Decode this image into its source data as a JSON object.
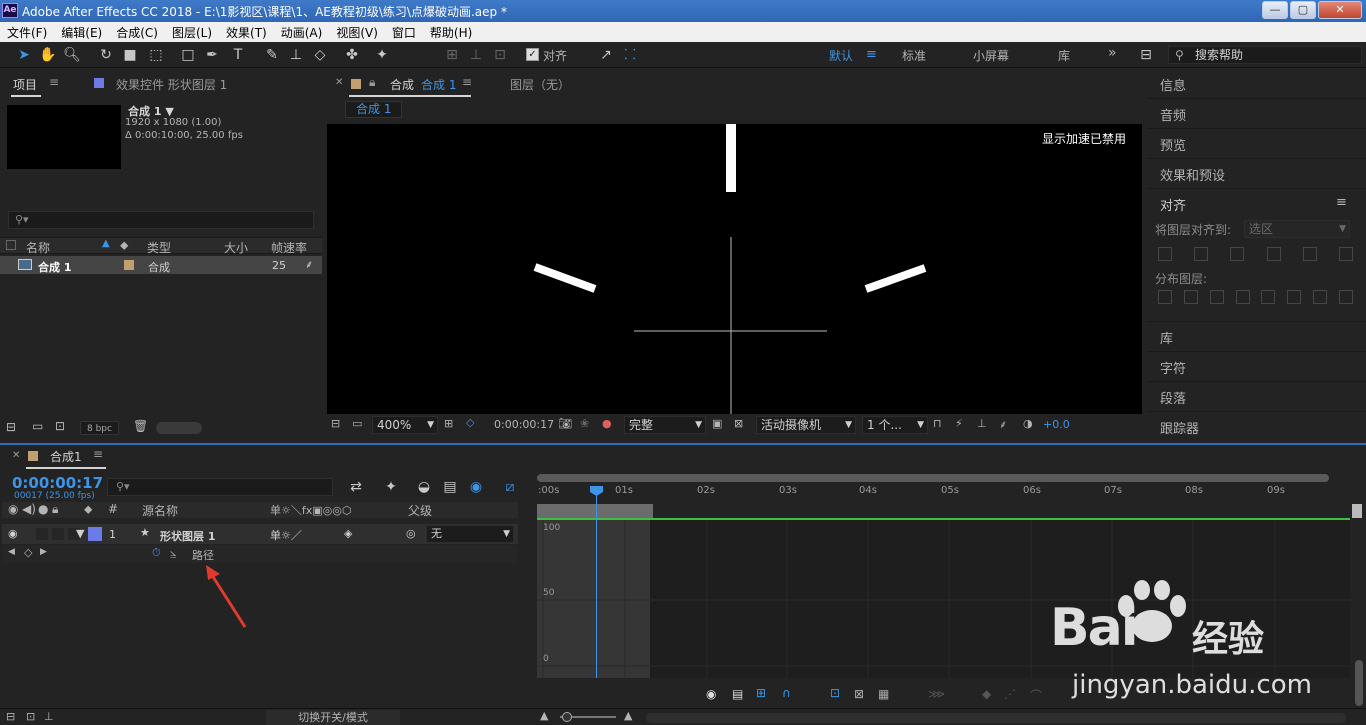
{
  "window": {
    "app_logo": "Ae",
    "title": "Adobe After Effects CC 2018 - E:\\1影视区\\课程\\1、AE教程初级\\练习\\点爆破动画.aep *",
    "buttons": {
      "minimize": "—",
      "maximize": "▢",
      "close": "✕"
    }
  },
  "menu": [
    "文件(F)",
    "编辑(E)",
    "合成(C)",
    "图层(L)",
    "效果(T)",
    "动画(A)",
    "视图(V)",
    "窗口",
    "帮助(H)"
  ],
  "toolbar": {
    "snap_label": "对齐",
    "workspaces": [
      "默认",
      "标准",
      "小屏幕",
      "库"
    ],
    "workspace_active": "默认",
    "more": "»",
    "search_placeholder": "搜索帮助"
  },
  "project": {
    "tab_project": "项目",
    "tab_effects": "效果控件 形状图层 1",
    "comp_name": "合成 1 ▼",
    "comp_resolution": "1920 x 1080 (1.00)",
    "comp_duration": "Δ 0:00:10:00, 25.00 fps",
    "search_placeholder": "⚲▾",
    "columns": [
      "名称",
      "类型",
      "大小",
      "帧速率"
    ],
    "rows": [
      {
        "name": "合成 1",
        "type": "合成",
        "size": "",
        "fps": "25"
      }
    ],
    "bpc": "8 bpc"
  },
  "composition": {
    "tab_label": "合成",
    "tab_comp_name": "合成 1",
    "tab_layer": "图层（无）",
    "breadcrumb": "合成 1",
    "gpu_notice": "显示加速已禁用",
    "zoom": "400%",
    "timecode": "0:00:00:17",
    "quality": "完整",
    "camera": "活动摄像机",
    "views": "1 个...",
    "exposure": "+0.0"
  },
  "right_panel": {
    "items": [
      "信息",
      "音频",
      "预览",
      "效果和预设",
      "对齐"
    ],
    "align_to_label": "将图层对齐到:",
    "align_to_value": "选区",
    "distribute_label": "分布图层:",
    "items_bottom": [
      "库",
      "字符",
      "段落",
      "跟踪器"
    ]
  },
  "timeline": {
    "tab": "合成1",
    "timecode": "0:00:00:17",
    "frame_info": "00017 (25.00 fps)",
    "search_placeholder": "⚲▾",
    "columns": {
      "num": "#",
      "source": "源名称",
      "switches": "单☼＼fx▣◎◎⬡",
      "parent": "父级"
    },
    "layer": {
      "index": "1",
      "name": "形状图层 1",
      "parent": "无"
    },
    "property": "路径",
    "ruler_ticks": [
      ":00s",
      "01s",
      "02s",
      "03s",
      "04s",
      "05s",
      "06s",
      "07s",
      "08s",
      "09s"
    ],
    "graph_labels": [
      "100",
      "50",
      "0"
    ],
    "footer_toggle": "切换开关/模式"
  },
  "watermark": {
    "brand_left": "Bai",
    "brand_right": "经验",
    "url": "jingyan.baidu.com"
  },
  "colors": {
    "accent": "#3c95e6",
    "layer_label": "#6b7be8",
    "comp_label": "#c0a070",
    "title_bar": "#3a74c2",
    "green": "#3fbf3f"
  }
}
